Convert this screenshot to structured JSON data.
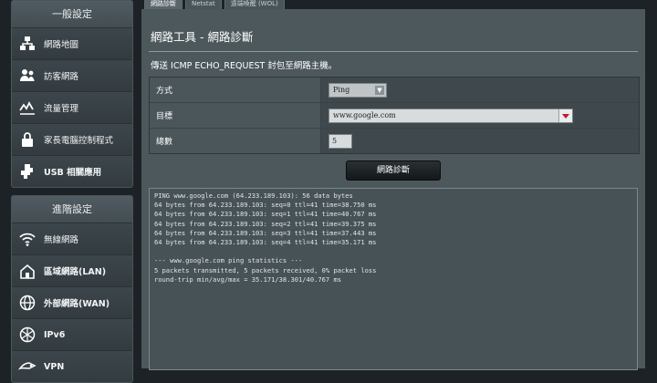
{
  "sidebar": {
    "general_title": "一般設定",
    "general_items": [
      {
        "label": "網路地圖",
        "icon": "network-map-icon"
      },
      {
        "label": "訪客網路",
        "icon": "guest-network-icon"
      },
      {
        "label": "流量管理",
        "icon": "traffic-manager-icon"
      },
      {
        "label": "家長電腦控制程式",
        "icon": "parental-control-icon"
      },
      {
        "label": "USB 相關應用",
        "icon": "usb-application-icon"
      }
    ],
    "advanced_title": "進階設定",
    "advanced_items": [
      {
        "label": "無線網路",
        "icon": "wireless-icon"
      },
      {
        "label": "區域網路(LAN)",
        "icon": "lan-icon"
      },
      {
        "label": "外部網路(WAN)",
        "icon": "wan-icon"
      },
      {
        "label": "IPv6",
        "icon": "ipv6-icon"
      },
      {
        "label": "VPN",
        "icon": "vpn-icon"
      }
    ]
  },
  "tabs": [
    {
      "label": "網路診斷"
    },
    {
      "label": "Netstat"
    },
    {
      "label": "遠端喚醒 (WOL)"
    }
  ],
  "main": {
    "title": "網路工具 - 網路診斷",
    "description": "傳送 ICMP ECHO_REQUEST 封包至網路主機。",
    "form": {
      "method_label": "方式",
      "method_value": "Ping",
      "target_label": "目標",
      "target_value": "www.google.com",
      "count_label": "總數",
      "count_value": "5"
    },
    "diagnose_button": "網路診斷",
    "result_lines": [
      "PING www.google.com (64.233.189.103): 56 data bytes",
      "64 bytes from 64.233.189.103: seq=0 ttl=41 time=38.750 ms",
      "64 bytes from 64.233.189.103: seq=1 ttl=41 time=40.767 ms",
      "64 bytes from 64.233.189.103: seq=2 ttl=41 time=39.375 ms",
      "64 bytes from 64.233.189.103: seq=3 ttl=41 time=37.443 ms",
      "64 bytes from 64.233.189.103: seq=4 ttl=41 time=35.171 ms",
      "",
      "--- www.google.com ping statistics ---",
      "5 packets transmitted, 5 packets received, 0% packet loss",
      "round-trip min/avg/max = 35.171/38.301/40.767 ms"
    ]
  }
}
